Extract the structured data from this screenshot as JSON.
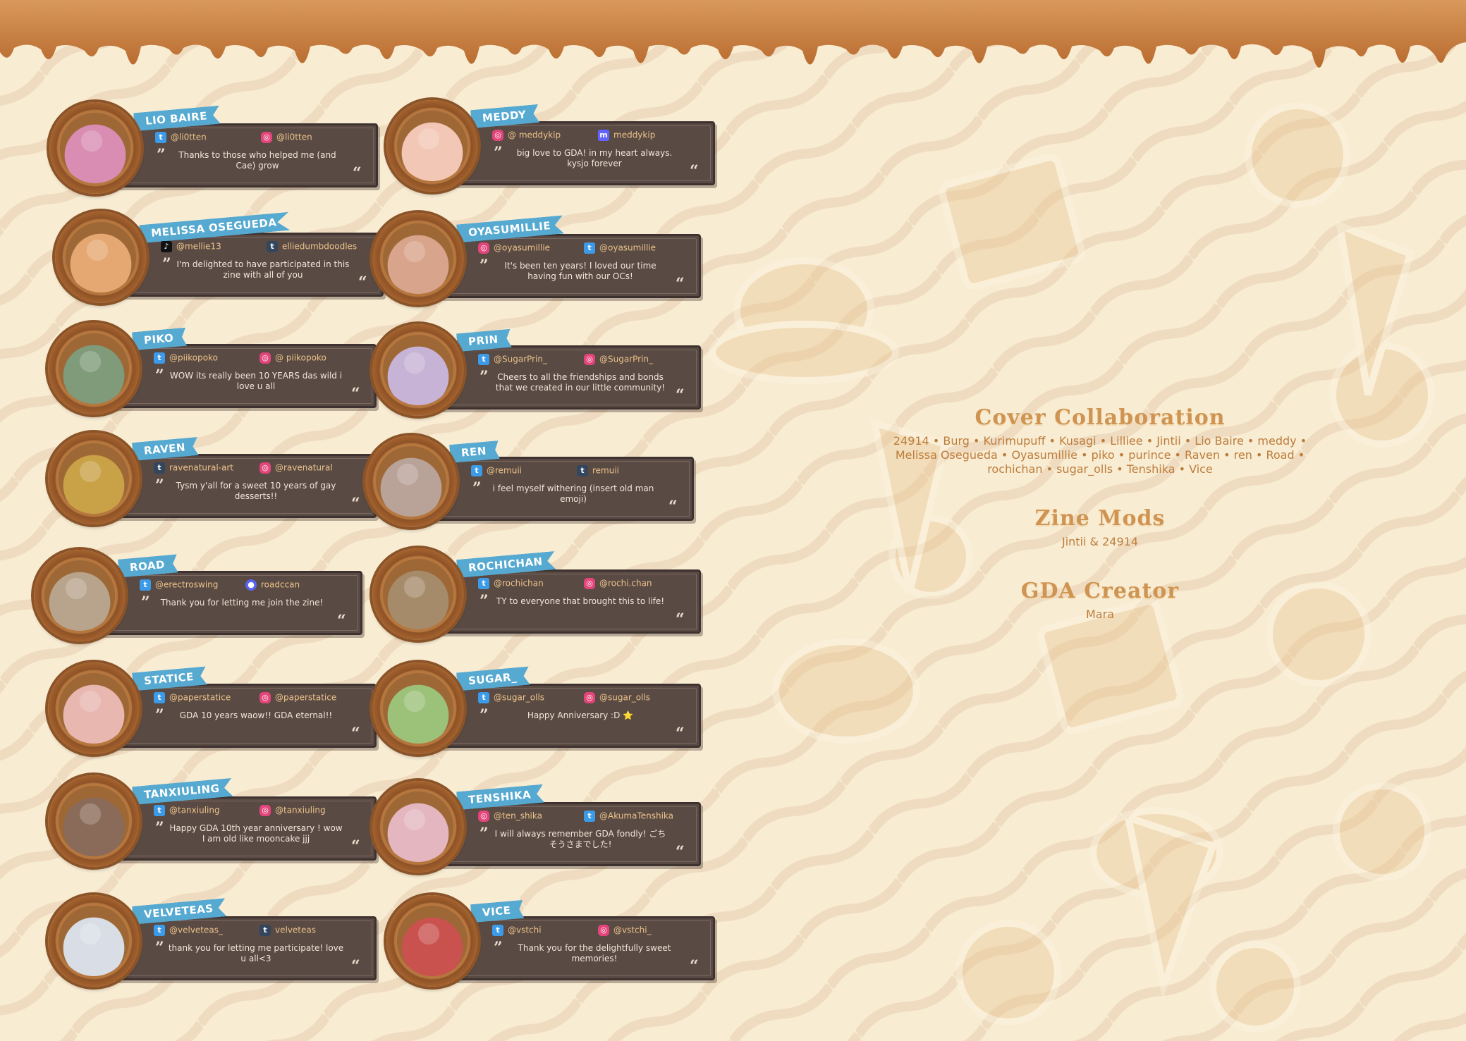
{
  "contributors": [
    {
      "name": "LIO BAIRE",
      "h1": {
        "icon": "twitter",
        "text": "@li0tten"
      },
      "h2": {
        "icon": "instagram",
        "text": "@li0tten"
      },
      "msg": "Thanks to those who helped me (and Cae) grow",
      "color": "#d98db3"
    },
    {
      "name": "MEDDY",
      "h1": {
        "icon": "instagram",
        "text": "@ meddykip"
      },
      "h2": {
        "icon": "mastodon",
        "text": "meddykip"
      },
      "msg": "big love to GDA! in my heart always. kysjo forever",
      "color": "#f2c7b6"
    },
    {
      "name": "MELISSA OSEGUEDA",
      "h1": {
        "icon": "tiktok",
        "text": "@mellie13"
      },
      "h2": {
        "icon": "tumblr",
        "text": "elliedumbdoodles"
      },
      "msg": "I'm delighted to have participated in this zine with all of you",
      "color": "#e6a872"
    },
    {
      "name": "OYASUMILLIE",
      "h1": {
        "icon": "instagram",
        "text": "@oyasumillie"
      },
      "h2": {
        "icon": "twitter",
        "text": "@oyasumillie"
      },
      "msg": "It's been ten years! I loved our time having fun with our OCs!",
      "color": "#d8a48b"
    },
    {
      "name": "PIKO",
      "h1": {
        "icon": "twitter",
        "text": "@piikopoko"
      },
      "h2": {
        "icon": "instagram",
        "text": "@ piikopoko"
      },
      "msg": "WOW its really been 10 YEARS das wild i love u all",
      "color": "#7f9b7a"
    },
    {
      "name": "PRIN",
      "h1": {
        "icon": "twitter",
        "text": "@SugarPrin_"
      },
      "h2": {
        "icon": "instagram",
        "text": "@SugarPrin_"
      },
      "msg": "Cheers to all the friendships and bonds that we created in our little community!",
      "color": "#c7b3d6"
    },
    {
      "name": "RAVEN",
      "h1": {
        "icon": "tumblr",
        "text": "ravenatural-art"
      },
      "h2": {
        "icon": "instagram",
        "text": "@ravenatural"
      },
      "msg": "Tysm y'all for a sweet 10 years of gay desserts!!",
      "color": "#c9a247"
    },
    {
      "name": "REN",
      "h1": {
        "icon": "twitter",
        "text": "@remuii"
      },
      "h2": {
        "icon": "tumblr",
        "text": "remuii"
      },
      "msg": "i feel myself withering (insert old man emoji)",
      "color": "#b9a399"
    },
    {
      "name": "ROAD",
      "h1": {
        "icon": "twitter",
        "text": "@erectroswing"
      },
      "h2": {
        "icon": "discord",
        "text": "roadccan"
      },
      "msg": "Thank you for letting me join the zine!",
      "color": "#b8a48c"
    },
    {
      "name": "ROCHICHAN",
      "h1": {
        "icon": "twitter",
        "text": "@rochichan"
      },
      "h2": {
        "icon": "instagram",
        "text": "@rochi.chan"
      },
      "msg": "TY to everyone that brought this to life!",
      "color": "#a68b6b"
    },
    {
      "name": "STATICE",
      "h1": {
        "icon": "twitter",
        "text": "@paperstatice"
      },
      "h2": {
        "icon": "instagram",
        "text": "@paperstatice"
      },
      "msg": "GDA 10 years waow!! GDA eternal!!",
      "color": "#e8b7b0"
    },
    {
      "name": "SUGAR_",
      "h1": {
        "icon": "twitter",
        "text": "@sugar_olls"
      },
      "h2": {
        "icon": "instagram",
        "text": "@sugar_olls"
      },
      "msg": "Happy Anniversary :D ⭐",
      "color": "#9cc27a"
    },
    {
      "name": "TANXIULING",
      "h1": {
        "icon": "twitter",
        "text": "@tanxiuling"
      },
      "h2": {
        "icon": "instagram",
        "text": "@tanxiuling"
      },
      "msg": "Happy GDA 10th year anniversary ! wow I am old like mooncake jjj",
      "color": "#8a6a58"
    },
    {
      "name": "TENSHIKA",
      "h1": {
        "icon": "instagram",
        "text": "@ten_shika"
      },
      "h2": {
        "icon": "twitter",
        "text": "@AkumaTenshika"
      },
      "msg": "I will always remember GDA fondly! ごちそうさまでした!",
      "color": "#e3b6c0"
    },
    {
      "name": "VELVETEAS",
      "h1": {
        "icon": "twitter",
        "text": "@velveteas_"
      },
      "h2": {
        "icon": "tumblr",
        "text": "velveteas"
      },
      "msg": "thank you for letting me participate! love u all<3",
      "color": "#d9dde6"
    },
    {
      "name": "VICE",
      "h1": {
        "icon": "twitter",
        "text": "@vstchi"
      },
      "h2": {
        "icon": "instagram",
        "text": "@vstchi_"
      },
      "msg": "Thank you for the delightfully sweet memories!",
      "color": "#c9524f"
    }
  ],
  "credits": {
    "cover_title": "Cover Collaboration",
    "cover_line1": "24914 • Burg • Kurimupuff • Kusagi • Lilliee • Jintii • Lio Baire • meddy •",
    "cover_line2": "Melissa Osegueda • Oyasumillie • piko • purince • Raven • ren • Road •",
    "cover_line3": "rochichan • sugar_olls • Tenshika • Vice",
    "mods_title": "Zine Mods",
    "mods_body": "Jintii & 24914",
    "creator_title": "GDA Creator",
    "creator_body": "Mara"
  },
  "colors": {
    "panel": "#5a4a44",
    "tag": "#56a9d0",
    "caramel": "#c7793a",
    "background": "#f8ecd3"
  }
}
